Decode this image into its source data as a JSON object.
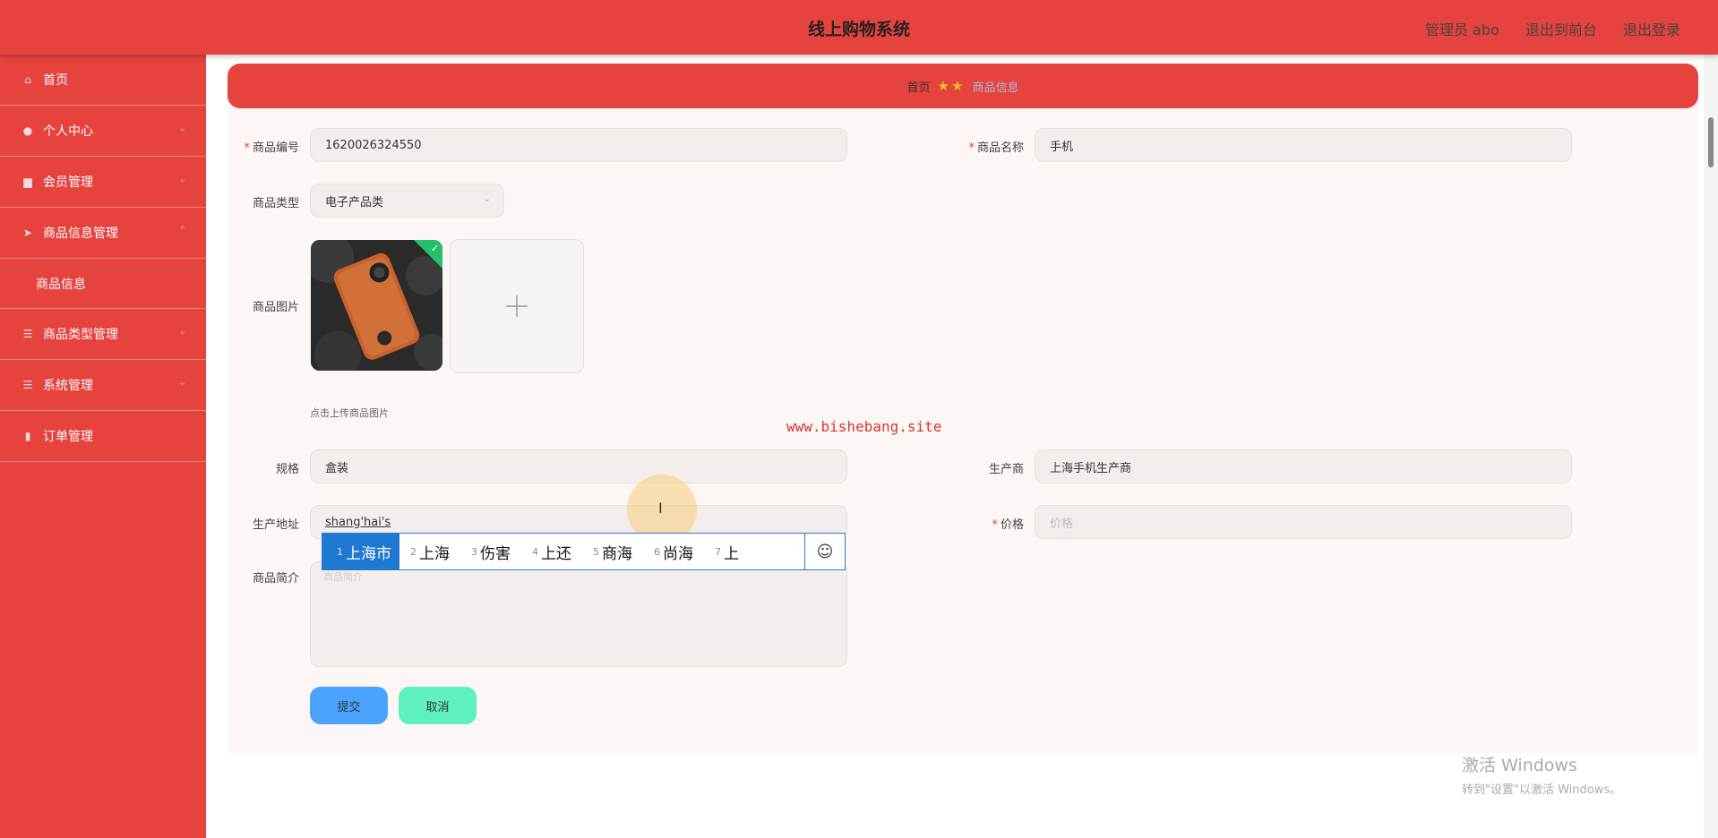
{
  "header": {
    "title": "线上购物系统",
    "admin_label": "管理员 abo",
    "to_frontend": "退出到前台",
    "logout": "退出登录"
  },
  "sidebar": {
    "items": [
      {
        "label": "首页",
        "icon": "home-icon"
      },
      {
        "label": "个人中心",
        "icon": "user-icon"
      },
      {
        "label": "会员管理",
        "icon": "members-icon"
      },
      {
        "label": "商品信息管理",
        "icon": "send-icon"
      },
      {
        "label": "商品信息",
        "icon": ""
      },
      {
        "label": "商品类型管理",
        "icon": "list-icon"
      },
      {
        "label": "系统管理",
        "icon": "settings-list-icon"
      },
      {
        "label": "订单管理",
        "icon": "chart-icon"
      }
    ]
  },
  "breadcrumb": {
    "home": "首页",
    "current": "商品信息"
  },
  "form": {
    "code_label": "商品编号",
    "code_value": "1620026324550",
    "name_label": "商品名称",
    "name_value": "手机",
    "type_label": "商品类型",
    "type_value": "电子产品类",
    "image_label": "商品图片",
    "upload_hint": "点击上传商品图片",
    "spec_label": "规格",
    "spec_value": "盒装",
    "maker_label": "生产商",
    "maker_value": "上海手机生产商",
    "address_label": "生产地址",
    "address_value": "shang'hai's",
    "price_label": "价格",
    "price_placeholder": "价格",
    "desc_label": "商品简介",
    "desc_placeholder": "商品简介",
    "submit": "提交",
    "cancel": "取消"
  },
  "ime": {
    "candidates": [
      {
        "n": "1",
        "text": "上海市"
      },
      {
        "n": "2",
        "text": "上海"
      },
      {
        "n": "3",
        "text": "伤害"
      },
      {
        "n": "4",
        "text": "上还"
      },
      {
        "n": "5",
        "text": "商海"
      },
      {
        "n": "6",
        "text": "尚海"
      },
      {
        "n": "7",
        "text": "上"
      }
    ],
    "emoji": "☺"
  },
  "watermark": "www.bishebang.site",
  "windows": {
    "line1": "激活 Windows",
    "line2": "转到\"设置\"以激活 Windows。"
  },
  "colors": {
    "primary_red": "#e6423e",
    "submit_blue": "#4aa3ff",
    "cancel_green": "#5ef0bd",
    "ime_blue": "#1f78d1"
  }
}
